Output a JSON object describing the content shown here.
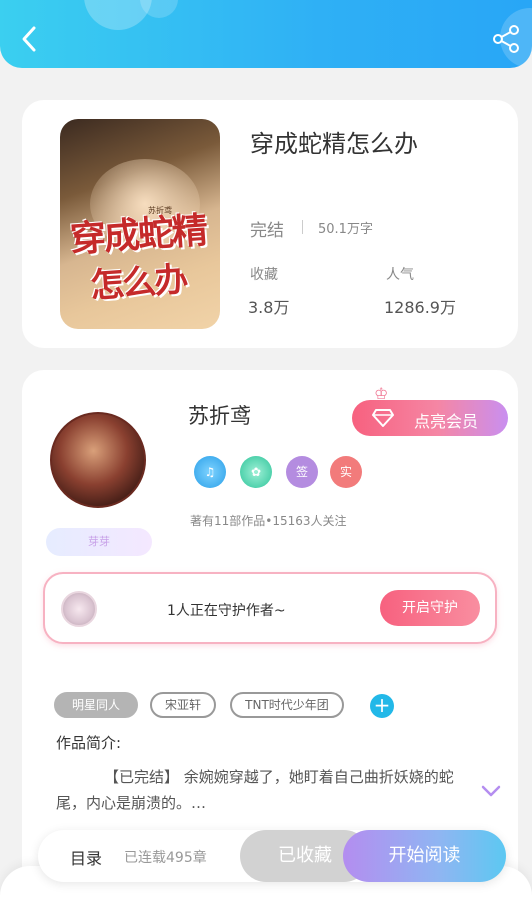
{
  "book": {
    "title": "穿成蛇精怎么办",
    "status": "完结",
    "word_count": "50.1万字",
    "collect_label": "收藏",
    "collect_value": "3.8万",
    "popularity_label": "人气",
    "popularity_value": "1286.9万",
    "cover_title_line1": "穿成蛇精",
    "cover_title_line2": "怎么办",
    "cover_author": "苏折鸢"
  },
  "author": {
    "name": "苏折鸢",
    "tag": "芽芽",
    "works_info": "著有11部作品•15163人关注",
    "badges": [
      "",
      "",
      "签",
      "实"
    ]
  },
  "vip": {
    "label": "点亮会员"
  },
  "guard": {
    "text": "1人正在守护作者~",
    "button": "开启守护"
  },
  "tags": [
    "明星同人",
    "宋亚轩",
    "TNT时代少年团"
  ],
  "intro": {
    "label": "作品简介:",
    "text": "【已完结】 余婉婉穿越了，她盯着自己曲折妖娆的蛇尾，内心是崩溃的。…"
  },
  "bottom": {
    "toc_label": "目录",
    "toc_status": "已连载495章",
    "collect_button": "已收藏",
    "read_button": "开始阅读"
  },
  "colors": {
    "topbar": "#2fb0f5",
    "accent_pink": "#f7617f",
    "accent_blue": "#22b8e8",
    "read_gradient_start": "#b48df0",
    "read_gradient_end": "#5cc8f2"
  }
}
